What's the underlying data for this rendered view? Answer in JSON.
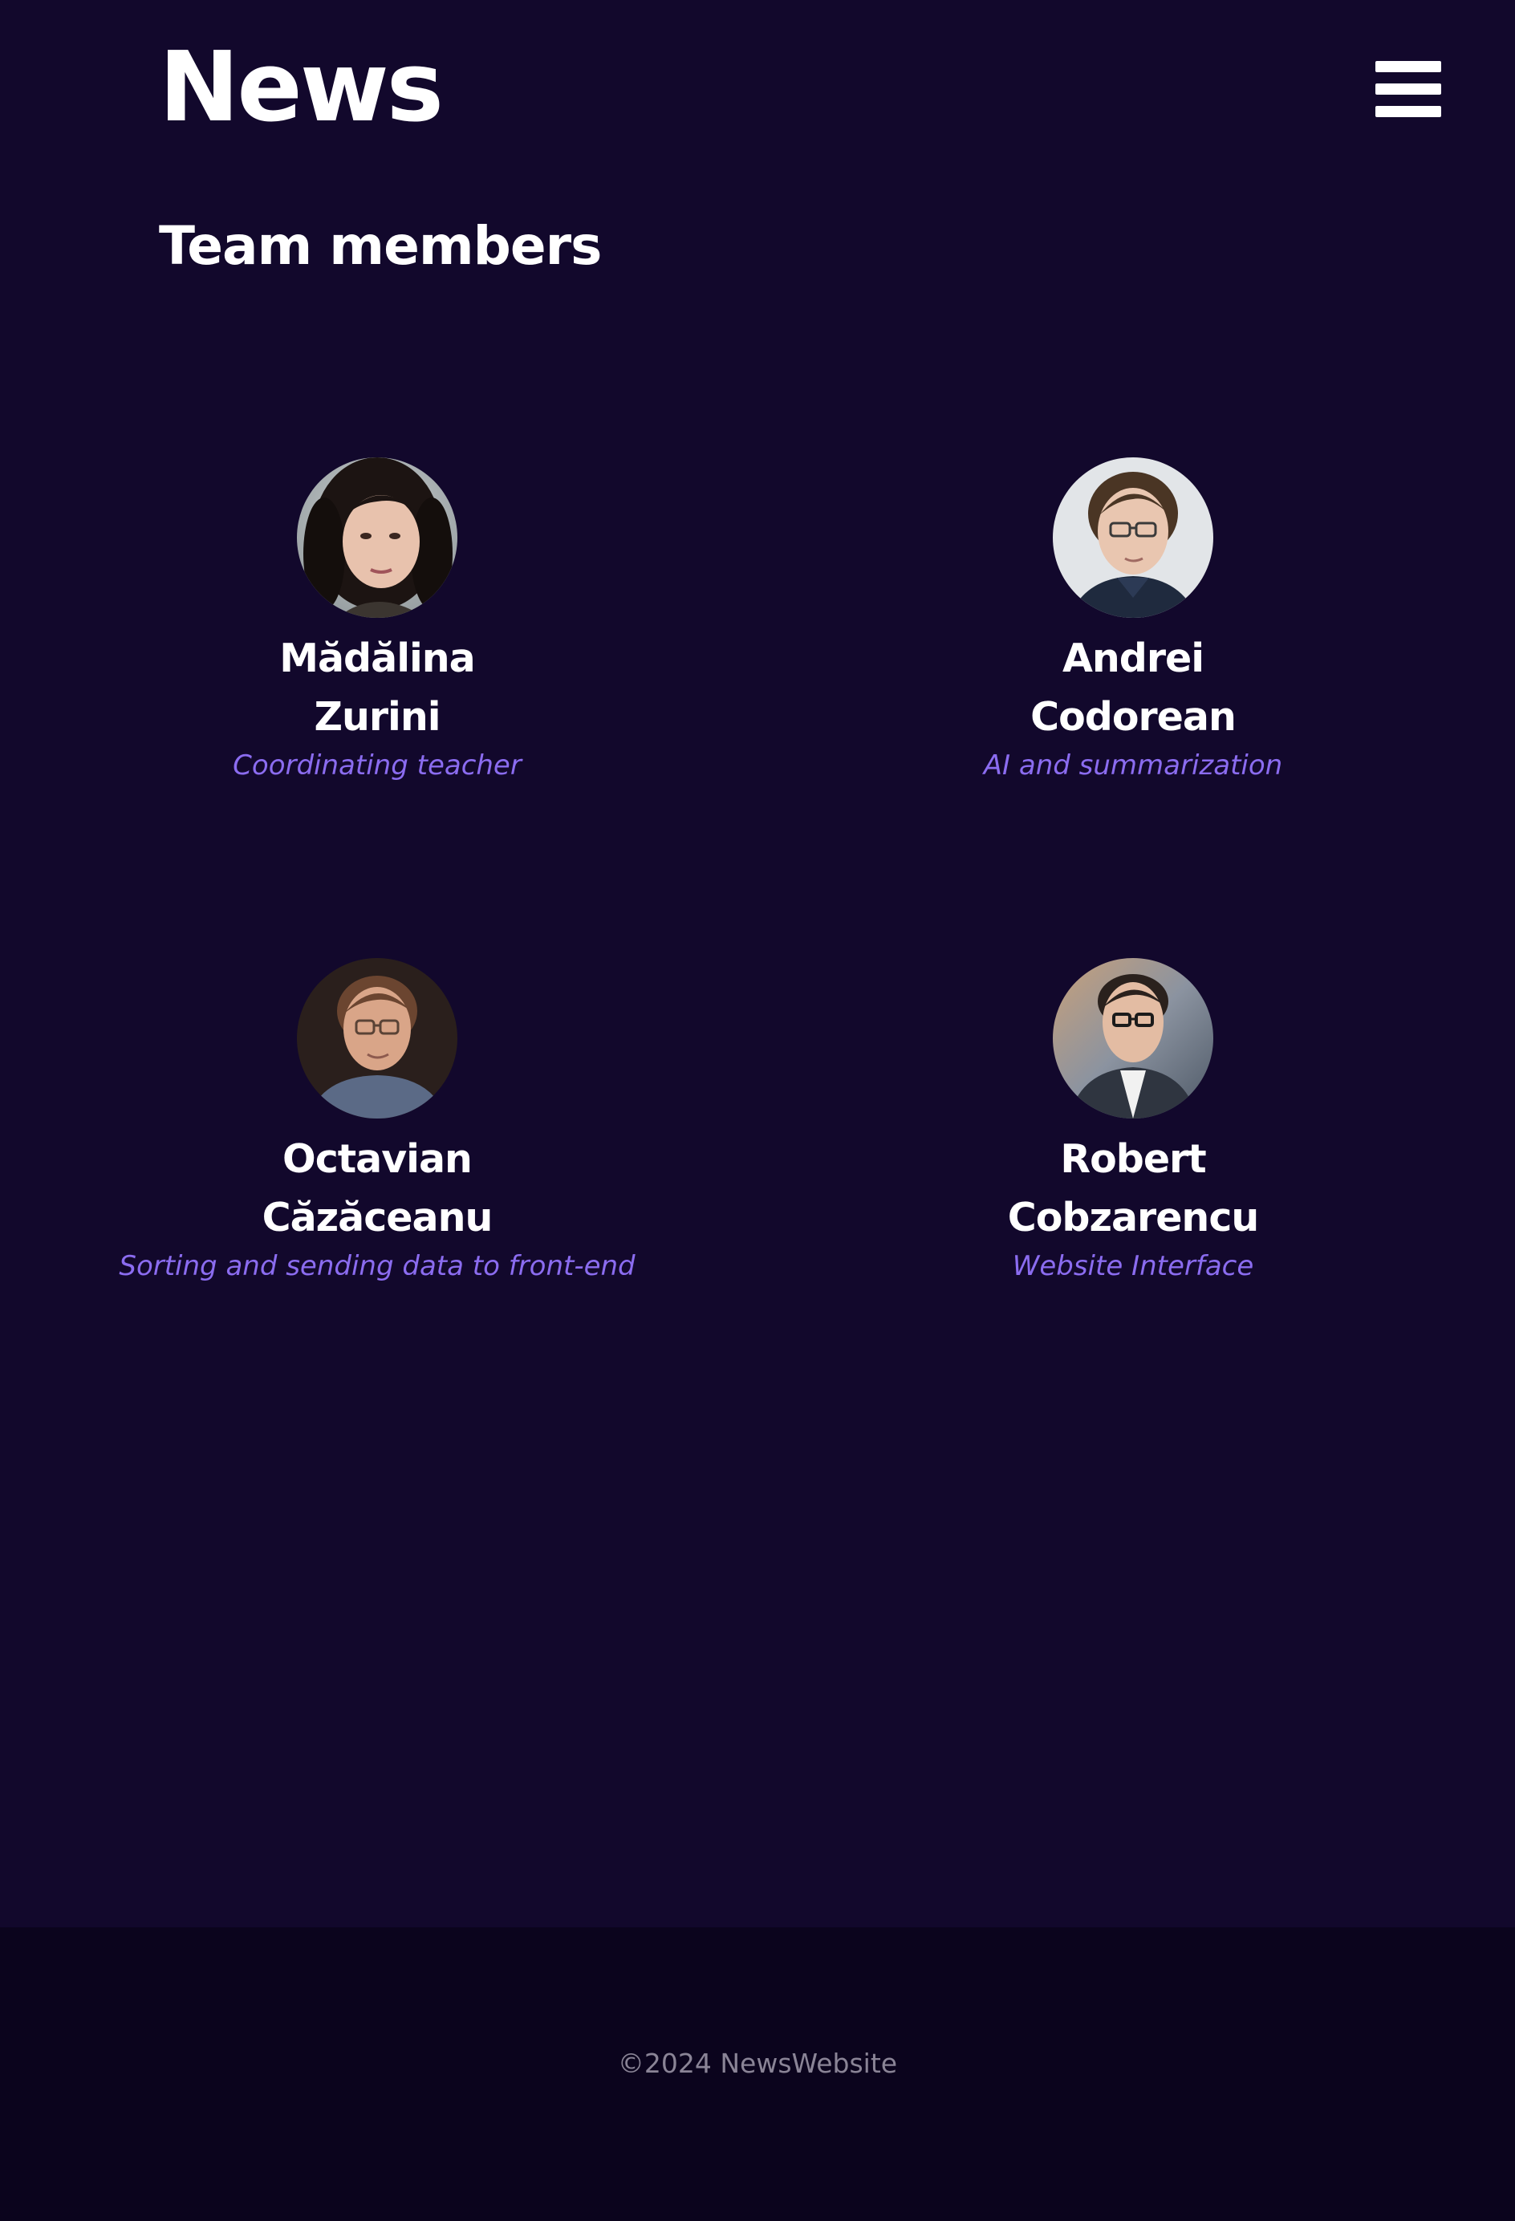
{
  "header": {
    "brand": "News",
    "menu_icon": "hamburger-menu-icon"
  },
  "team": {
    "title": "Team members",
    "members": [
      {
        "first_name": "Mădălina",
        "last_name": "Zurini",
        "role": "Coordinating teacher",
        "avatar": "portrait-photo-woman-dark-curly-hair"
      },
      {
        "first_name": "Andrei",
        "last_name": "Codorean",
        "role": "AI and summarization",
        "avatar": "portrait-photo-man-glasses"
      },
      {
        "first_name": "Octavian",
        "last_name": "Căzăceanu",
        "role": "Sorting and sending data to front-end",
        "avatar": "portrait-photo-man-glasses-sweater"
      },
      {
        "first_name": "Robert",
        "last_name": "Cobzarencu",
        "role": "Website Interface",
        "avatar": "portrait-photo-man-glasses-denim-jacket"
      }
    ]
  },
  "footer": {
    "copyright": "©2024 NewsWebsite"
  },
  "colors": {
    "background": "#12082c",
    "footer_background": "#0b041d",
    "accent": "#8b6cf0",
    "text": "#ffffff",
    "footer_text": "#8a8496"
  }
}
